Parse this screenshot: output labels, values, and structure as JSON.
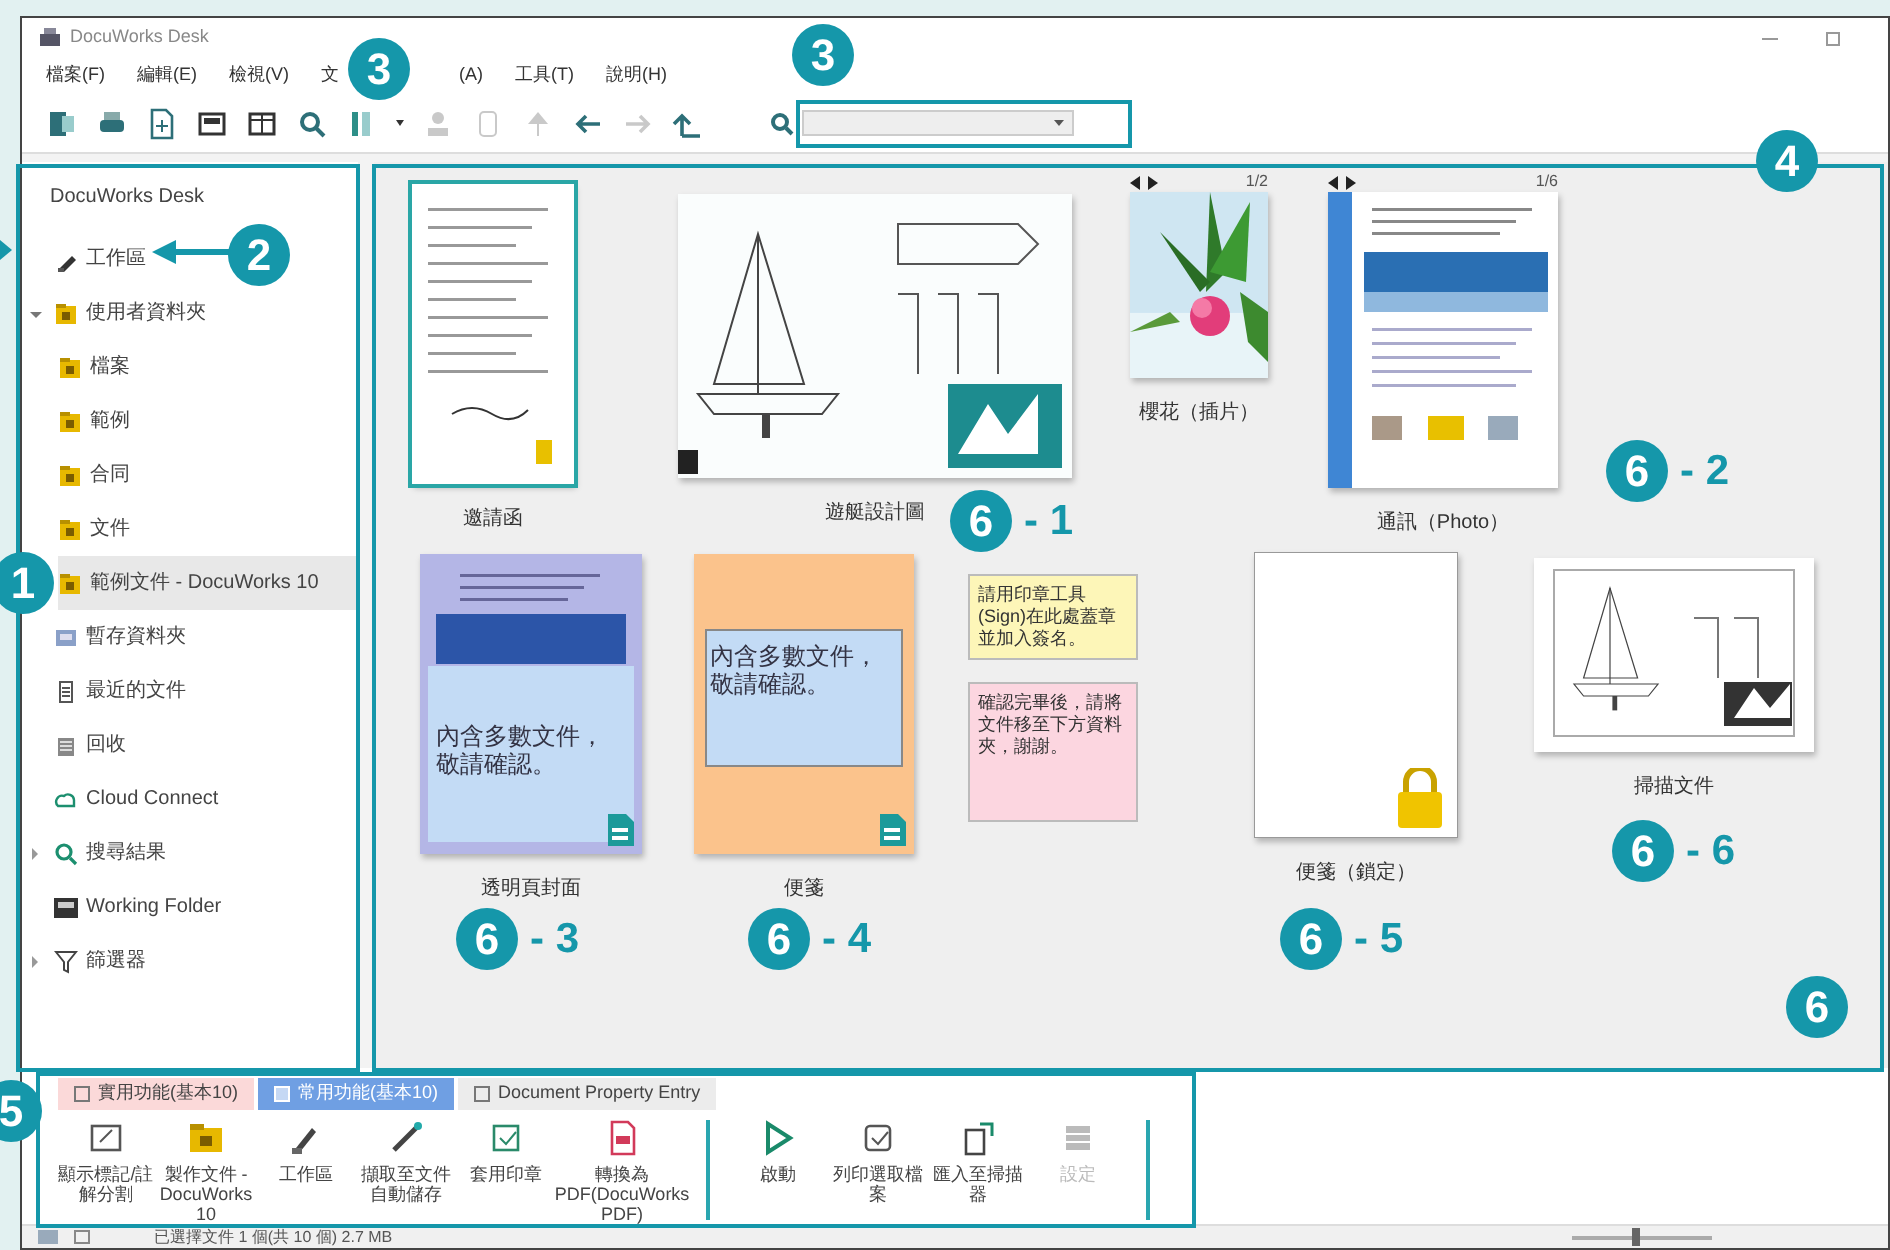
{
  "window": {
    "title": "DocuWorks Desk"
  },
  "menu": [
    "檔案(F)",
    "編輯(E)",
    "檢視(V)",
    "文",
    "(A)",
    "工具(T)",
    "說明(H)"
  ],
  "toolbar": [
    {
      "disabled": false
    },
    {
      "disabled": false
    },
    {
      "disabled": false
    },
    {
      "disabled": false
    },
    {
      "disabled": false
    },
    {
      "disabled": false
    },
    {
      "disabled": false
    },
    {
      "disabled": true
    },
    {
      "disabled": true
    },
    {
      "disabled": true
    },
    {
      "disabled": false
    },
    {
      "disabled": true
    },
    {
      "disabled": false
    }
  ],
  "search": {
    "kind": "dropdown"
  },
  "sidebar": {
    "title": "DocuWorks Desk",
    "items": [
      {
        "kind": "workspace",
        "label": "工作區",
        "selected": false
      },
      {
        "kind": "folder",
        "label": "使用者資料夾",
        "selected": false,
        "expanded": true,
        "children": [
          {
            "kind": "folder",
            "label": "檔案",
            "selected": false
          },
          {
            "kind": "folder",
            "label": "範例",
            "selected": false
          },
          {
            "kind": "folder",
            "label": "合同",
            "selected": false
          },
          {
            "kind": "folder",
            "label": "文件",
            "selected": false
          },
          {
            "kind": "folder",
            "label": "範例文件 - DocuWorks 10",
            "selected": true
          }
        ]
      },
      {
        "kind": "tray",
        "label": "暫存資料夾",
        "selected": false
      },
      {
        "kind": "recent",
        "label": "最近的文件",
        "selected": false
      },
      {
        "kind": "trash",
        "label": "回收",
        "selected": false
      },
      {
        "kind": "cloud",
        "label": "Cloud Connect",
        "selected": false
      },
      {
        "kind": "search",
        "label": "搜尋結果",
        "selected": false,
        "expanded": false
      },
      {
        "kind": "working",
        "label": "Working Folder",
        "selected": false
      },
      {
        "kind": "filter",
        "label": "篩選器",
        "selected": false,
        "expanded": false
      }
    ]
  },
  "documents": [
    {
      "kind": "letter",
      "label": "邀請函",
      "selected": true
    },
    {
      "kind": "drawing",
      "label": "遊艇設計圖",
      "selected": false
    },
    {
      "label": "櫻花（插片）",
      "counter": "1/2",
      "selected": false
    },
    {
      "kind": "newsletter",
      "label": "通訊（Photo）",
      "counter": "1/6",
      "selected": false
    },
    {
      "kind": "cover",
      "label": "透明頁封面",
      "note": "內含多數文件，敬請確認。",
      "selected": false
    },
    {
      "kind": "memo",
      "label": "便箋",
      "note": "內含多數文件，敬請確認。",
      "selected": false
    },
    {
      "kind": "sticky",
      "note": "請用印章工具(Sign)在此處蓋章並加入簽名。",
      "color": "#fdf6b8"
    },
    {
      "kind": "sticky",
      "note": "確認完畢後，請將文件移至下方資料夾，謝謝。",
      "color": "#fcd6e0"
    },
    {
      "kind": "locked",
      "label": "便箋（鎖定）",
      "selected": false
    },
    {
      "kind": "scan",
      "label": "掃描文件",
      "selected": false
    }
  ],
  "ribbon": {
    "tabs": [
      {
        "label": "實用功能(基本10)",
        "selected": false
      },
      {
        "label": "常用功能(基本10)",
        "selected": true
      },
      {
        "label": "Document Property Entry",
        "selected": false
      }
    ],
    "buttons": [
      {
        "label": "顯示標記/註解分割",
        "disabled": false
      },
      {
        "label": "製作文件 - DocuWorks 10",
        "disabled": false
      },
      {
        "label": "工作區",
        "disabled": false
      },
      {
        "label": "擷取至文件自動儲存",
        "disabled": false
      },
      {
        "label": "套用印章",
        "disabled": false
      },
      {
        "label": "轉換為 PDF(DocuWorks PDF)",
        "disabled": false
      },
      {
        "label": "啟動",
        "disabled": false
      },
      {
        "label": "列印選取檔案",
        "disabled": false
      },
      {
        "label": "匯入至掃描器",
        "disabled": false
      },
      {
        "label": "設定",
        "disabled": true
      }
    ]
  },
  "status_bar": {
    "text": "已選擇文件 1 個(共 10 個) 2.7 MB",
    "zoom": {
      "level": 0.45
    }
  },
  "callouts": [
    {
      "number": "1"
    },
    {
      "number": "2"
    },
    {
      "number": "3"
    },
    {
      "number": "3"
    },
    {
      "number": "4"
    },
    {
      "number": "5"
    },
    {
      "number": "6"
    },
    {
      "number": "6",
      "suffix": "- 1"
    },
    {
      "number": "6",
      "suffix": "- 2"
    },
    {
      "number": "6",
      "suffix": "- 3"
    },
    {
      "number": "6",
      "suffix": "- 4"
    },
    {
      "number": "6",
      "suffix": "- 5"
    },
    {
      "number": "6",
      "suffix": "- 6"
    }
  ]
}
